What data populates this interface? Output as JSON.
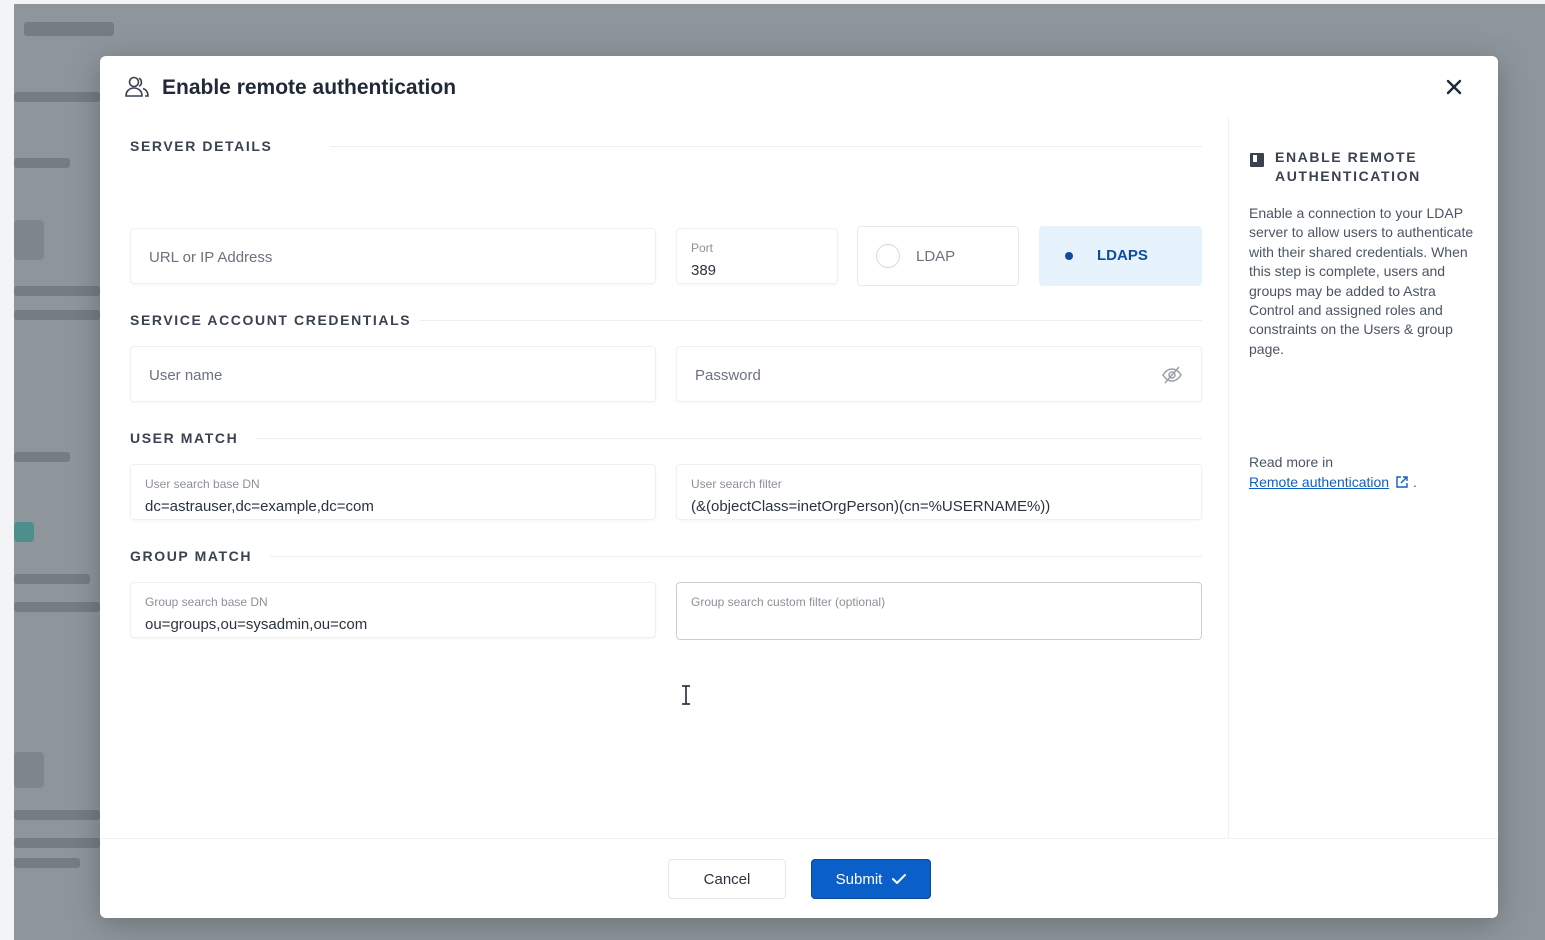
{
  "modal": {
    "title": "Enable remote authentication",
    "close_label": "×"
  },
  "server_details": {
    "section_label": "SERVER DETAILS",
    "url_placeholder": "URL or IP Address",
    "port_label": "Port",
    "port_value": "389",
    "protocol_options": [
      {
        "label": "LDAP",
        "selected": false
      },
      {
        "label": "LDAPS",
        "selected": true
      }
    ]
  },
  "credentials": {
    "section_label": "SERVICE ACCOUNT CREDENTIALS",
    "username_placeholder": "User name",
    "password_placeholder": "Password"
  },
  "user_match": {
    "section_label": "USER MATCH",
    "base_dn_label": "User search base DN",
    "base_dn_value": "dc=astrauser,dc=example,dc=com",
    "filter_label": "User search filter",
    "filter_value": "(&(objectClass=inetOrgPerson)(cn=%USERNAME%))"
  },
  "group_match": {
    "section_label": "GROUP MATCH",
    "base_dn_label": "Group search base DN",
    "base_dn_value": "ou=groups,ou=sysadmin,ou=com",
    "filter_label": "Group search custom filter (optional)",
    "filter_value": ""
  },
  "side_panel": {
    "title": "ENABLE REMOTE AUTHENTICATION",
    "description": "Enable a connection to your LDAP server to allow users to authenticate with their shared credentials. When this step is complete, users and groups may be added to Astra Control and assigned roles and constraints on the Users & group page.",
    "read_more": "Read more in",
    "link_text": "Remote authentication",
    "link_suffix": "."
  },
  "footer": {
    "cancel_label": "Cancel",
    "submit_label": "Submit"
  },
  "colors": {
    "primary": "#0b5fc8",
    "selected_bg": "#e6f2fc",
    "selected_text": "#0f4a9c",
    "backdrop": "#8e969c"
  }
}
